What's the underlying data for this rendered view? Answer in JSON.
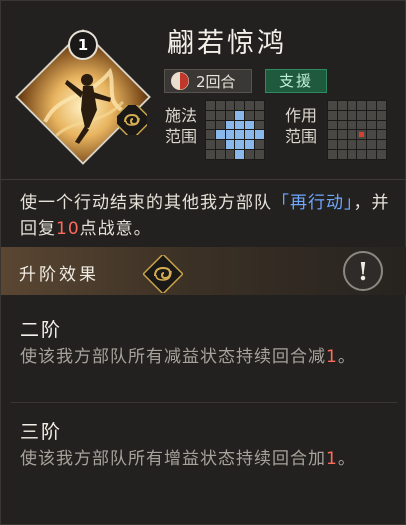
{
  "skill": {
    "level": "1",
    "name": "翩若惊鸿",
    "cooldown": "2回合",
    "type_tag": "支援"
  },
  "range": {
    "cast_label_1": "施法",
    "cast_label_2": "范围",
    "effect_label_1": "作用",
    "effect_label_2": "范围"
  },
  "description": {
    "part1": "使一个行动结束的其他我方部队",
    "link": "「再行动」",
    "part2": "，并回复",
    "number": "10",
    "part3": "点战意。"
  },
  "upgrade": {
    "title": "升阶效果"
  },
  "tiers": [
    {
      "title": "二阶",
      "text_before": "使该我方部队所有减益状态持续回合减",
      "value": "1",
      "text_after": "。"
    },
    {
      "title": "三阶",
      "text_before": "使该我方部队所有增益状态持续回合加",
      "value": "1",
      "text_after": "。"
    }
  ],
  "colors": {
    "link": "#6ea7ff",
    "number": "#ff6a5a",
    "type_tag_bg": "#1f5a3f",
    "cast_cell": "#8ab8ea",
    "effect_cell": "#d64030"
  },
  "icons": {
    "cloud": "cloud-pattern-icon",
    "cooldown": "cooldown-clock-icon",
    "info": "exclamation-icon",
    "portrait": "dancer-portrait"
  }
}
